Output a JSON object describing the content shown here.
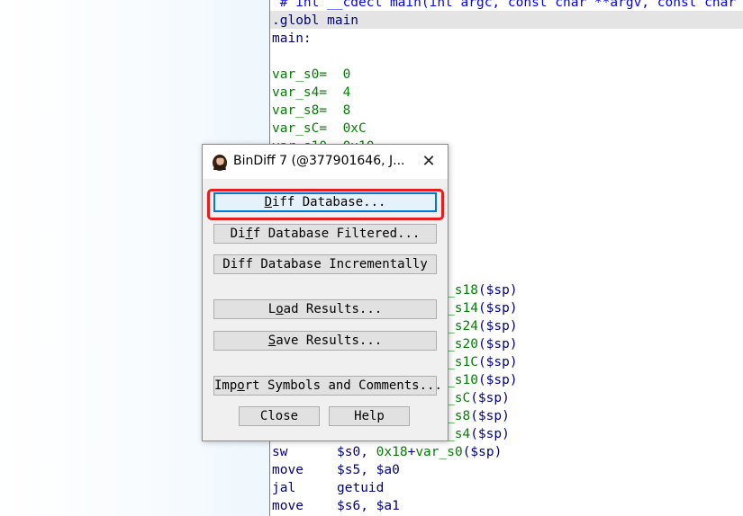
{
  "code": {
    "comment_line": " # int __cdecl main(int argc, const char **argv, const char",
    "globl_line": ".globl main",
    "label_line": "main:",
    "vars": [
      {
        "name": "var_s0=",
        "value": "0"
      },
      {
        "name": "var_s4=",
        "value": "4"
      },
      {
        "name": "var_s8=",
        "value": "8"
      },
      {
        "name": "var_sC=",
        "value": "0xC"
      },
      {
        "name": "var_s10=",
        "value": "0x10"
      }
    ],
    "right_fragments": [
      {
        "num": "s18",
        "tail": "($sp)"
      },
      {
        "num": "s14",
        "tail": "($sp)"
      },
      {
        "num": "s24",
        "tail": "($sp)"
      },
      {
        "num": "s20",
        "tail": "($sp)"
      },
      {
        "num": "s1C",
        "tail": "($sp)"
      },
      {
        "num": "s10",
        "tail": "($sp)"
      },
      {
        "num": "sC",
        "tail": "($sp)"
      },
      {
        "num": "s8",
        "tail": "($sp)"
      },
      {
        "num": "s4",
        "tail": "($sp)"
      }
    ],
    "instructions": [
      {
        "mnemonic": "sw",
        "reg": "$s0, ",
        "num": "0x18",
        "rest": "+",
        "var": "var_s0",
        "tail": "($sp)"
      },
      {
        "mnemonic": "move",
        "reg": "$s5, $a0"
      },
      {
        "mnemonic": "jal",
        "reg": "getuid"
      },
      {
        "mnemonic": "move",
        "reg": "$s6, $a1"
      }
    ]
  },
  "dialog": {
    "title": "BinDiff 7 (@377901646, J...",
    "close_glyph": "✕",
    "icon": "bindiff-app-icon",
    "buttons": {
      "diff_database": {
        "pre": "",
        "mnemonic": "D",
        "post": "iff Database..."
      },
      "diff_database_filtered": {
        "pre": "Di",
        "mnemonic": "f",
        "post": "f Database Filtered..."
      },
      "diff_database_incrementally": {
        "pre": "Diff Database Incrementally",
        "mnemonic": "",
        "post": ""
      },
      "load_results": {
        "pre": "L",
        "mnemonic": "o",
        "post": "ad Results..."
      },
      "save_results": {
        "pre": "",
        "mnemonic": "S",
        "post": "ave Results..."
      },
      "import_symbols": {
        "pre": "Imp",
        "mnemonic": "o",
        "post": "rt Symbols and Comments..."
      },
      "close": "Close",
      "help": "Help"
    }
  },
  "colors": {
    "highlight_box": "#e81c1c",
    "code_green": "#008000",
    "code_navy": "#000080",
    "comment_blue": "#0000ff"
  }
}
